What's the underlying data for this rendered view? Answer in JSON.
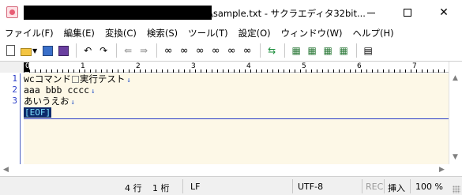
{
  "window": {
    "title": "\\sample.txt - サクラエディタ32bit..."
  },
  "menu": {
    "items": [
      "ファイル(F)",
      "編集(E)",
      "変換(C)",
      "検索(S)",
      "ツール(T)",
      "設定(O)",
      "ウィンドウ(W)",
      "ヘルプ(H)"
    ]
  },
  "ruler": {
    "labels": [
      "0",
      "1",
      "2",
      "3",
      "4",
      "5",
      "6",
      "7"
    ]
  },
  "editor": {
    "line_numbers": [
      "1",
      "2",
      "3"
    ],
    "lines": {
      "l1_a": "wcコマンド",
      "l1_b": "実行テスト",
      "l2": "aaa bbb cccc",
      "l3": "あいうえお"
    },
    "eol_mark": "↓",
    "eof_mark": "[EOF]"
  },
  "status": {
    "row": "4 行",
    "col": "1 桁",
    "newline": "LF",
    "encoding": "UTF-8",
    "rec": "REC",
    "mode": "挿入",
    "zoom": "100 %"
  },
  "colors": {
    "text_background": "#fdf8e7",
    "line_number": "#2a3cc8",
    "eof_background": "#0d2a6b",
    "eof_text": "#7de0ff"
  }
}
